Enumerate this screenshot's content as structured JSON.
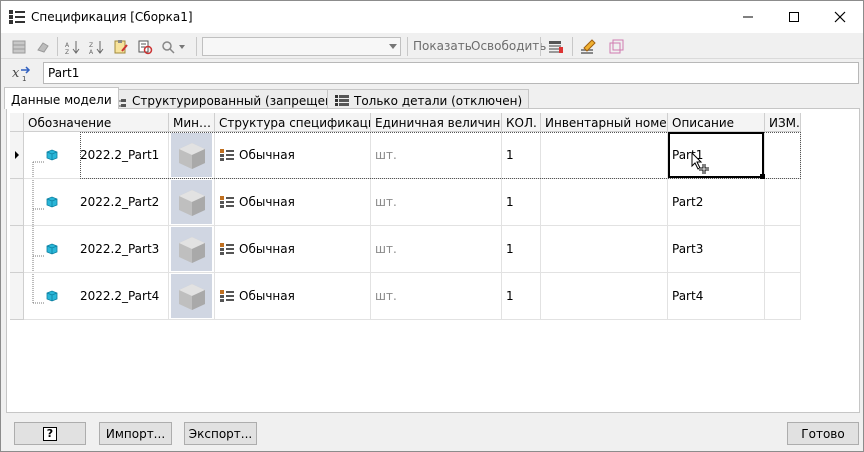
{
  "window": {
    "title": "Спецификация [Сборка1]"
  },
  "toolbar": {
    "combo_value": "",
    "show_label": "Показать",
    "release_label": "Освободить"
  },
  "formula": {
    "value": "Part1"
  },
  "tabs": [
    {
      "label": "Данные модели"
    },
    {
      "label": "Структурированный (запрещено)"
    },
    {
      "label": "Только детали (отключен)"
    }
  ],
  "columns": [
    {
      "label": "Обозначение"
    },
    {
      "label": "Мин…"
    },
    {
      "label": "Структура спецификации"
    },
    {
      "label": "Единичная величина"
    },
    {
      "label": "КОЛ."
    },
    {
      "label": "Инвентарный номер"
    },
    {
      "label": "Описание"
    },
    {
      "label": "ИЗМ."
    }
  ],
  "rows": [
    {
      "designation": "2022.2_Part1",
      "structure": "Обычная",
      "unit": "шт.",
      "qty": "1",
      "inventory": "",
      "description": "Part1",
      "rev": ""
    },
    {
      "designation": "2022.2_Part2",
      "structure": "Обычная",
      "unit": "шт.",
      "qty": "1",
      "inventory": "",
      "description": "Part2",
      "rev": ""
    },
    {
      "designation": "2022.2_Part3",
      "structure": "Обычная",
      "unit": "шт.",
      "qty": "1",
      "inventory": "",
      "description": "Part3",
      "rev": ""
    },
    {
      "designation": "2022.2_Part4",
      "structure": "Обычная",
      "unit": "шт.",
      "qty": "1",
      "inventory": "",
      "description": "Part4",
      "rev": ""
    }
  ],
  "footer": {
    "help_label": "?",
    "import_label": "Импорт...",
    "export_label": "Экспорт...",
    "done_label": "Готово"
  },
  "colors": {
    "cube": "#29b6d8",
    "thumb_bg": "#d0d6e2"
  }
}
